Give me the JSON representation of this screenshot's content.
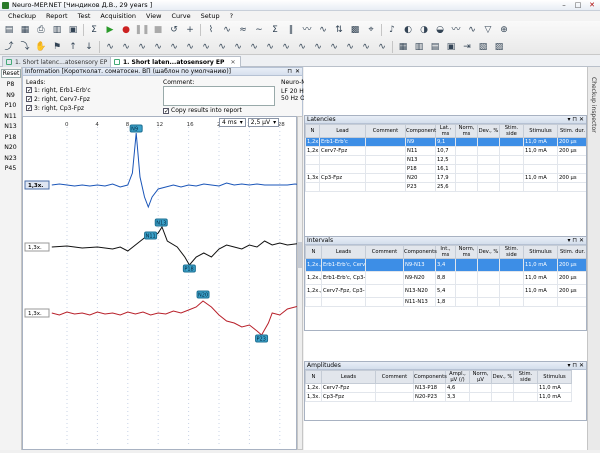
{
  "titlebar": {
    "title": "Neuro-MEP.NET [Чиндиков Д.В., 29 years ]"
  },
  "menu": [
    "Checkup",
    "Report",
    "Test",
    "Acquisition",
    "View",
    "Curve",
    "Setup",
    "?"
  ],
  "tabs": [
    {
      "label": "1. Short latenc...atosensory EP",
      "close": "✕"
    },
    {
      "label": "1. Short laten...atosensory EP",
      "close": "✕"
    }
  ],
  "left": {
    "reset_label": "Reset",
    "peaks": [
      "P8",
      "N9",
      "P10",
      "N11",
      "N13",
      "P18",
      "N20",
      "N23",
      "P45"
    ]
  },
  "info": {
    "title": "Information [Коротколат. соматосен. ВП (шаблон по умолчанию)]",
    "leads_label": "Leads:",
    "leads": [
      "1: right, Erb1-Erb'c",
      "2: right, Cerv7-Fpz",
      "3: right, Cp3-Fpz"
    ],
    "comment_label": "Comment:",
    "copy_label": "Copy results into report",
    "amp_title": "Neuro-MEP-4 amplifier",
    "amp_filters": "LF 20 Hz, HF 2 kHz",
    "amp_notch": "50 Hz Off, Range 1 mV"
  },
  "plot": {
    "time_scale": "4 ms",
    "amp_scale": "2,5 μV",
    "ticks": [
      "0",
      "4",
      "8",
      "12",
      "16",
      "20",
      "24",
      "28",
      "32"
    ],
    "traces": [
      {
        "label": "1,3x.",
        "markers": [
          "N9"
        ]
      },
      {
        "label": "1,3x.",
        "markers": [
          "N13",
          "N11",
          "P18"
        ]
      },
      {
        "label": "1,3x.",
        "markers": [
          "N20",
          "P23"
        ]
      }
    ]
  },
  "latencies": {
    "title": "Latencies",
    "headers": [
      "N",
      "Lead",
      "Comment",
      "Component",
      "Lat., ms",
      "Norm, ms",
      "Dev., %",
      "Stim. side",
      "Stimulus",
      "Stim. dur."
    ],
    "rows": [
      [
        "1,2x.",
        "Erb1-Erb'c",
        "",
        "N9",
        "9,1",
        "",
        "",
        "",
        "11,0 mA",
        "200 μs"
      ],
      [
        "1,2x.",
        "Cerv7-Fpz",
        "",
        "N11",
        "10,7",
        "",
        "",
        "",
        "11,0 mA",
        "200 μs"
      ],
      [
        "",
        "",
        "",
        "N13",
        "12,5",
        "",
        "",
        "",
        "",
        ""
      ],
      [
        "",
        "",
        "",
        "P18",
        "16,1",
        "",
        "",
        "",
        "",
        ""
      ],
      [
        "1,3x.",
        "Cp3-Fpz",
        "",
        "N20",
        "17,9",
        "",
        "",
        "",
        "11,0 mA",
        "200 μs"
      ],
      [
        "",
        "",
        "",
        "P23",
        "25,6",
        "",
        "",
        "",
        "",
        ""
      ]
    ]
  },
  "intervals": {
    "title": "Intervals",
    "headers": [
      "N",
      "Leads",
      "Comment",
      "Components",
      "Int., ms",
      "Norm, ms",
      "Dev., %",
      "Stim. side",
      "Stimulus",
      "Stim. dur."
    ],
    "rows": [
      [
        "1,2x., 1,2x.",
        "Erb1-Erb'c, Cerv7-Fpz",
        "",
        "N9-N13",
        "3,4",
        "",
        "",
        "",
        "11,0 mA",
        "200 μs"
      ],
      [
        "1,2x., 1,3x.",
        "Erb1-Erb'c, Cp3-Fpz",
        "",
        "N9-N20",
        "8,8",
        "",
        "",
        "",
        "11,0 mA",
        "200 μs"
      ],
      [
        "1,2x., 1,3x.",
        "Cerv7-Fpz, Cp3-Fpz",
        "",
        "N13-N20",
        "5,4",
        "",
        "",
        "",
        "11,0 mA",
        "200 μs"
      ],
      [
        "",
        "",
        "",
        "N11-N13",
        "1,8",
        "",
        "",
        "",
        "",
        ""
      ]
    ]
  },
  "amplitudes": {
    "title": "Amplitudes",
    "headers": [
      "N",
      "Leads",
      "Comment",
      "Components",
      "Ampl., μV (/)",
      "Norm, μV",
      "Dev., %",
      "Stim. side",
      "Stimulus"
    ],
    "rows": [
      [
        "1,2x.",
        "Cerv7-Fpz",
        "",
        "N13-P18",
        "4,6",
        "",
        "",
        "",
        "11,0 mA"
      ],
      [
        "1,3x.",
        "Cp3-Fpz",
        "",
        "N20-P23",
        "3,3",
        "",
        "",
        "",
        "11,0 mA"
      ]
    ]
  },
  "dock": {
    "checkup_inspector": "Checkup inspector"
  },
  "colors": {
    "selection": "#3d8ee6",
    "trace1": "#1a55b8",
    "trace2": "#111111",
    "trace3": "#b8202a",
    "marker": "#3aa0c8"
  }
}
